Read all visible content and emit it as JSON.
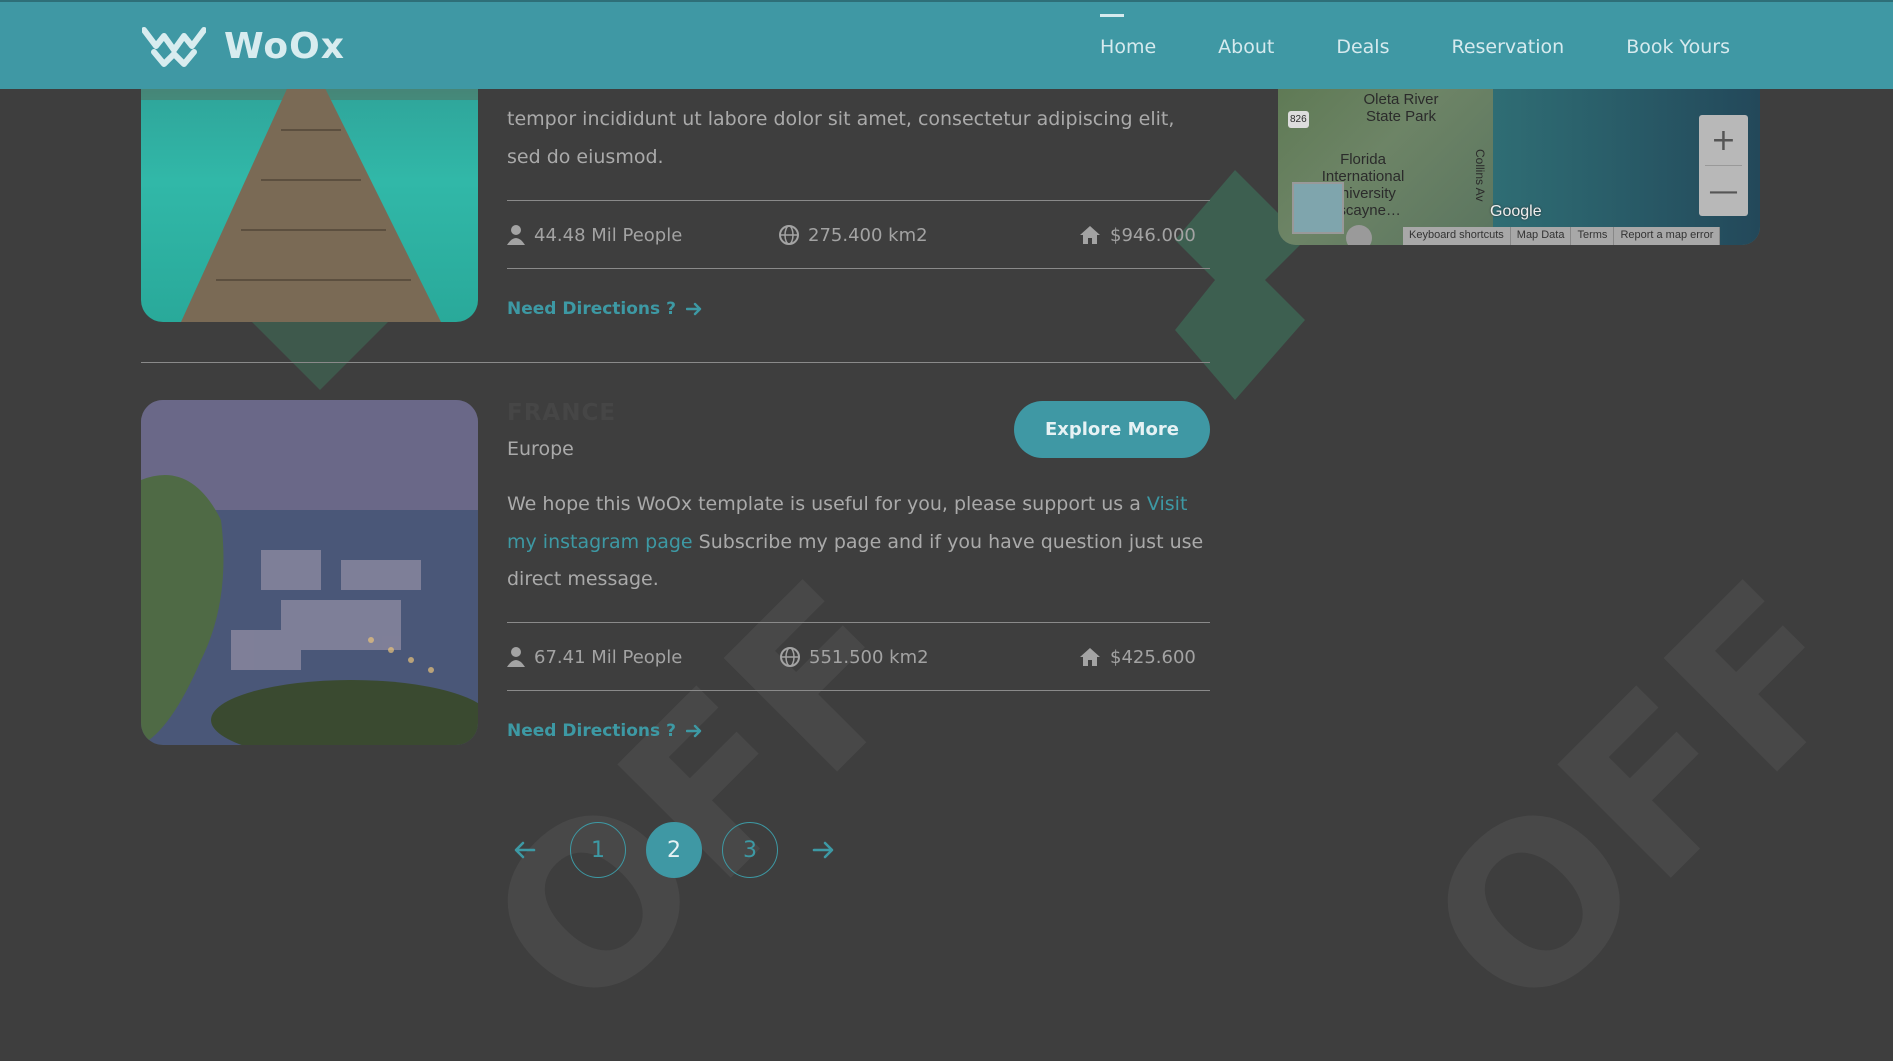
{
  "brand": {
    "name": "WoOx"
  },
  "nav": {
    "items": [
      {
        "label": "Home",
        "active": true
      },
      {
        "label": "About",
        "active": false
      },
      {
        "label": "Deals",
        "active": false
      },
      {
        "label": "Reservation",
        "active": false
      },
      {
        "label": "Book Yours",
        "active": false
      }
    ]
  },
  "map": {
    "labels": {
      "oleta": "Oleta River State Park",
      "fiu": "Florida International University Biscayne…",
      "collins": "Collins Av",
      "road": "826"
    },
    "google": "Google",
    "footer": [
      "Keyboard shortcuts",
      "Map Data",
      "Terms",
      "Report a map error"
    ],
    "zoom_in": "+",
    "zoom_out": "—"
  },
  "cards": [
    {
      "paragraph": "tempor incididunt ut labore dolor sit amet, consectetur adipiscing elit, sed do eiusmod.",
      "people": "44.48 Mil People",
      "area": "275.400 km2",
      "price": "$946.000",
      "directions": "Need Directions ?"
    },
    {
      "country": "FRANCE",
      "region": "Europe",
      "explore": "Explore More",
      "paragraph_pre": "We hope this WoOx template is useful for you, please support us a ",
      "paragraph_link": "Visit my instagram page",
      "paragraph_post": " Subscribe my page and if you have question just use direct message.",
      "people": "67.41 Mil People",
      "area": "551.500 km2",
      "price": "$425.600",
      "directions": "Need Directions ?"
    }
  ],
  "pagination": {
    "pages": [
      "1",
      "2",
      "3"
    ],
    "active": "2"
  },
  "colors": {
    "accent": "#3f98a4",
    "background": "#3e3e3e",
    "text": "#aaaaaa"
  }
}
